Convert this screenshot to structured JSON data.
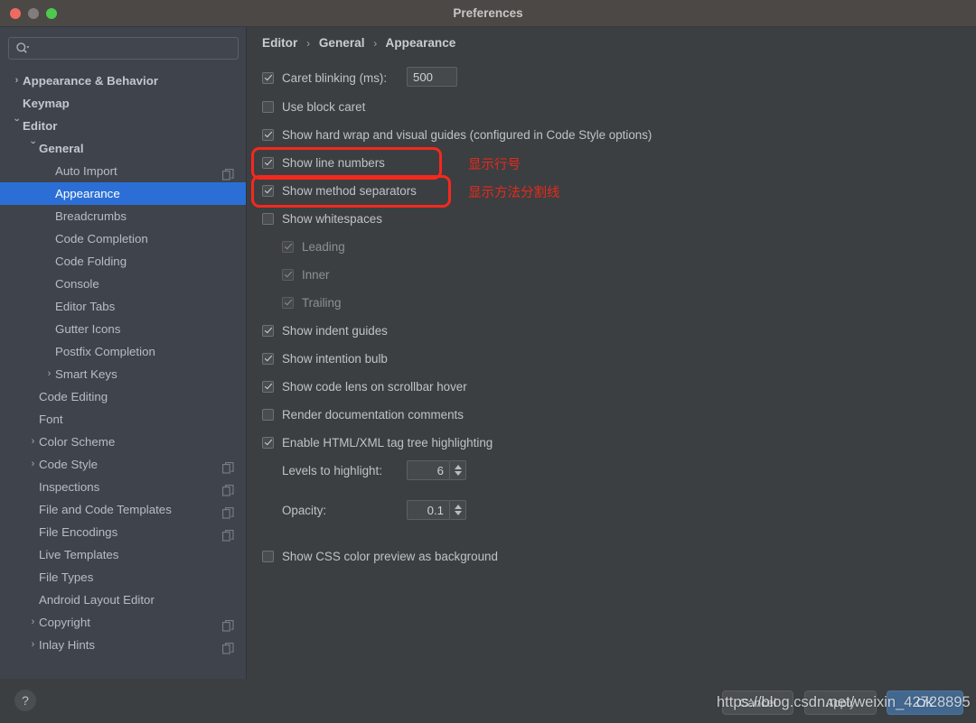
{
  "window": {
    "title": "Preferences",
    "traffic_lights": [
      "close",
      "minimize",
      "zoom"
    ]
  },
  "sidebar": {
    "search": {
      "value": "",
      "placeholder": ""
    },
    "items": [
      {
        "label": "Appearance & Behavior",
        "level": 0,
        "arrow": "collapsed",
        "bold": true,
        "selected": false,
        "copy": false
      },
      {
        "label": "Keymap",
        "level": 0,
        "arrow": "none",
        "bold": true,
        "selected": false,
        "copy": false
      },
      {
        "label": "Editor",
        "level": 0,
        "arrow": "expanded",
        "bold": true,
        "selected": false,
        "copy": false
      },
      {
        "label": "General",
        "level": 1,
        "arrow": "expanded",
        "bold": true,
        "selected": false,
        "copy": false
      },
      {
        "label": "Auto Import",
        "level": 2,
        "arrow": "none",
        "bold": false,
        "selected": false,
        "copy": true
      },
      {
        "label": "Appearance",
        "level": 2,
        "arrow": "none",
        "bold": false,
        "selected": true,
        "copy": false
      },
      {
        "label": "Breadcrumbs",
        "level": 2,
        "arrow": "none",
        "bold": false,
        "selected": false,
        "copy": false
      },
      {
        "label": "Code Completion",
        "level": 2,
        "arrow": "none",
        "bold": false,
        "selected": false,
        "copy": false
      },
      {
        "label": "Code Folding",
        "level": 2,
        "arrow": "none",
        "bold": false,
        "selected": false,
        "copy": false
      },
      {
        "label": "Console",
        "level": 2,
        "arrow": "none",
        "bold": false,
        "selected": false,
        "copy": false
      },
      {
        "label": "Editor Tabs",
        "level": 2,
        "arrow": "none",
        "bold": false,
        "selected": false,
        "copy": false
      },
      {
        "label": "Gutter Icons",
        "level": 2,
        "arrow": "none",
        "bold": false,
        "selected": false,
        "copy": false
      },
      {
        "label": "Postfix Completion",
        "level": 2,
        "arrow": "none",
        "bold": false,
        "selected": false,
        "copy": false
      },
      {
        "label": "Smart Keys",
        "level": 2,
        "arrow": "collapsed",
        "bold": false,
        "selected": false,
        "copy": false
      },
      {
        "label": "Code Editing",
        "level": 1,
        "arrow": "none",
        "bold": false,
        "selected": false,
        "copy": false
      },
      {
        "label": "Font",
        "level": 1,
        "arrow": "none",
        "bold": false,
        "selected": false,
        "copy": false
      },
      {
        "label": "Color Scheme",
        "level": 1,
        "arrow": "collapsed",
        "bold": false,
        "selected": false,
        "copy": false
      },
      {
        "label": "Code Style",
        "level": 1,
        "arrow": "collapsed",
        "bold": false,
        "selected": false,
        "copy": true
      },
      {
        "label": "Inspections",
        "level": 1,
        "arrow": "none",
        "bold": false,
        "selected": false,
        "copy": true
      },
      {
        "label": "File and Code Templates",
        "level": 1,
        "arrow": "none",
        "bold": false,
        "selected": false,
        "copy": true
      },
      {
        "label": "File Encodings",
        "level": 1,
        "arrow": "none",
        "bold": false,
        "selected": false,
        "copy": true
      },
      {
        "label": "Live Templates",
        "level": 1,
        "arrow": "none",
        "bold": false,
        "selected": false,
        "copy": false
      },
      {
        "label": "File Types",
        "level": 1,
        "arrow": "none",
        "bold": false,
        "selected": false,
        "copy": false
      },
      {
        "label": "Android Layout Editor",
        "level": 1,
        "arrow": "none",
        "bold": false,
        "selected": false,
        "copy": false
      },
      {
        "label": "Copyright",
        "level": 1,
        "arrow": "collapsed",
        "bold": false,
        "selected": false,
        "copy": true
      },
      {
        "label": "Inlay Hints",
        "level": 1,
        "arrow": "collapsed",
        "bold": false,
        "selected": false,
        "copy": true
      }
    ]
  },
  "content": {
    "breadcrumb": {
      "part1": "Editor",
      "part2": "General",
      "part3": "Appearance",
      "separator": "›"
    },
    "settings": [
      {
        "label": "Caret blinking (ms):",
        "checked": true,
        "enabled": true,
        "indent": 0
      },
      {
        "label": "Use block caret",
        "checked": false,
        "enabled": true,
        "indent": 0
      },
      {
        "label": "Show hard wrap and visual guides (configured in Code Style options)",
        "checked": true,
        "enabled": true,
        "indent": 0
      },
      {
        "label": "Show line numbers",
        "checked": true,
        "enabled": true,
        "indent": 0
      },
      {
        "label": "Show method separators",
        "checked": true,
        "enabled": true,
        "indent": 0
      },
      {
        "label": "Show whitespaces",
        "checked": false,
        "enabled": true,
        "indent": 0
      },
      {
        "label": "Leading",
        "checked": true,
        "enabled": false,
        "indent": 1
      },
      {
        "label": "Inner",
        "checked": true,
        "enabled": false,
        "indent": 1
      },
      {
        "label": "Trailing",
        "checked": true,
        "enabled": false,
        "indent": 1
      },
      {
        "label": "Show indent guides",
        "checked": true,
        "enabled": true,
        "indent": 0
      },
      {
        "label": "Show intention bulb",
        "checked": true,
        "enabled": true,
        "indent": 0
      },
      {
        "label": "Show code lens on scrollbar hover",
        "checked": true,
        "enabled": true,
        "indent": 0
      },
      {
        "label": "Render documentation comments",
        "checked": false,
        "enabled": true,
        "indent": 0
      },
      {
        "label": "Enable HTML/XML tag tree highlighting",
        "checked": true,
        "enabled": true,
        "indent": 0
      },
      {
        "label": "Show CSS color preview as background",
        "checked": false,
        "enabled": true,
        "indent": 0
      }
    ],
    "caret_blinking_value": "500",
    "levels_to_highlight": {
      "label": "Levels to highlight:",
      "value": "6"
    },
    "opacity": {
      "label": "Opacity:",
      "value": "0.1"
    }
  },
  "annotations": {
    "note1": "显示行号",
    "note2": "显示方法分割线",
    "box_color": "#f5281e",
    "text_color": "#e8291c"
  },
  "footer": {
    "help_label": "?",
    "cancel_label": "Cancel",
    "apply_label": "Apply",
    "ok_label": "OK",
    "watermark": "https://blog.csdn.net/weixin_42728895"
  },
  "colors": {
    "titlebar": "#4b4846",
    "sidebar_bg": "#3f434c",
    "content_bg": "#3c3f41",
    "selection": "#2b6fd6",
    "primary_button": "#43688f"
  }
}
